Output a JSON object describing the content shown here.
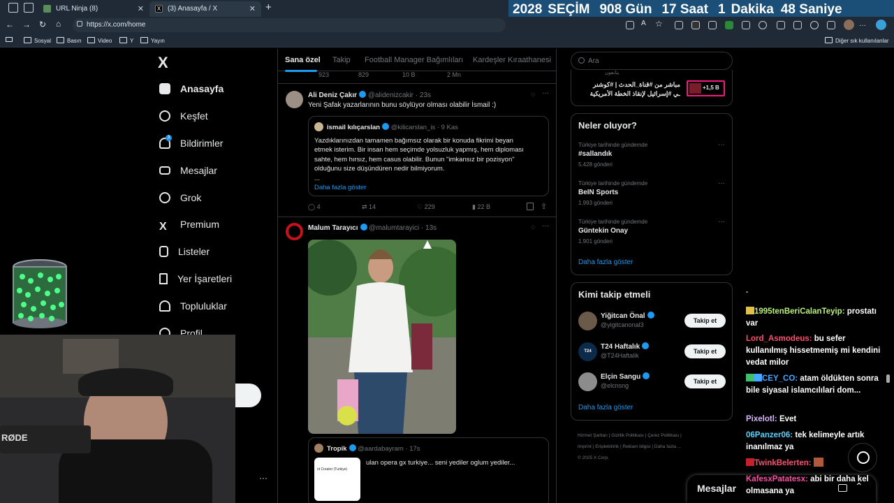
{
  "browser": {
    "tabs": [
      {
        "label": "URL Ninja (8)"
      },
      {
        "label": "(3) Anasayfa / X"
      }
    ],
    "url": "https://x.com/home",
    "bookmarks": [
      "Sosyal",
      "Basın",
      "Video",
      "Y",
      "Yayın"
    ],
    "other_bookmarks": "Diğer sık kullanılanlar",
    "new_tab": "+"
  },
  "timer": {
    "year": "2028",
    "label": "SEÇİM",
    "days": "908 Gün",
    "hours": "17 Saat",
    "minutes_num": "1",
    "minutes_label": "Dakika",
    "seconds": "48 Saniye"
  },
  "sidebar": {
    "logo": "X",
    "items": [
      {
        "label": "Anasayfa"
      },
      {
        "label": "Keşfet"
      },
      {
        "label": "Bildirimler"
      },
      {
        "label": "Mesajlar"
      },
      {
        "label": "Grok"
      },
      {
        "label": "Premium"
      },
      {
        "label": "Listeler"
      },
      {
        "label": "Yer İşaretleri"
      },
      {
        "label": "Topluluklar"
      },
      {
        "label": "Profil"
      }
    ],
    "notification_badge": "3"
  },
  "feed": {
    "tabs": [
      "Sana özel",
      "Takip",
      "Football Manager Bağımlıları",
      "Kardeşler Kıraathanesi"
    ],
    "top_actions": [
      "923",
      "829",
      "10 B",
      "2 Mn"
    ],
    "tweet1": {
      "name": "Ali Deniz Çakır",
      "handle": "@alidenizcakir",
      "time": "· 23s",
      "text": "Yeni Şafak yazarlarının bunu söylüyor olması olabilir İsmail :)",
      "quote": {
        "name": "ismail kılıçarslan",
        "handle": "@kilicarslan_is",
        "time": "· 9 Kas",
        "lines": [
          "Yazdıklarınızdan tamamen bağımsız olarak bir konuda fikrimi beyan",
          "etmek isterim. Bir insan hem seçimde yolsuzluk yapmış, hem diploması",
          "sahte, hem hırsız, hem casus olabilir. Bunun \"imkansız bir pozisyon\"",
          "olduğunu size düşündüren nedir bilmiyorum.",
          "..."
        ],
        "more": "Daha fazla göster"
      },
      "actions": {
        "replies": "4",
        "reposts": "14",
        "likes": "229",
        "views": "22 B"
      }
    },
    "tweet2": {
      "name": "Malum Tarayıcı",
      "handle": "@malumtarayici",
      "time": "· 13s",
      "quote": {
        "name": "Tropik",
        "handle": "@aardabayram",
        "time": "· 17s",
        "text": "ulan opera gx turkiye... seni yediler oglum yediler...",
        "thumb_text": "nt Creator (Turkiye)"
      }
    }
  },
  "right": {
    "search_placeholder": "Ara",
    "ad": {
      "line1": "مباشر من #قناة_الحدث | #كوشنر",
      "line2": "ـي #إسرائيل لإنقاذ الخطة الأمريكية",
      "top": "يتابعون",
      "badge": "+1,5 B"
    },
    "trends_title": "Neler oluyor?",
    "trends": [
      {
        "category": "Türkiye tarihinde gündemde",
        "name": "#sallandık",
        "count": "5.428 gönderi"
      },
      {
        "category": "Türkiye tarihinde gündemde",
        "name": "BeIN Sports",
        "count": "1.993 gönderi"
      },
      {
        "category": "Türkiye tarihinde gündemde",
        "name": "Güntekin Onay",
        "count": "1.901 gönderi"
      }
    ],
    "show_more": "Daha fazla göster",
    "follow_title": "Kimi takip etmeli",
    "follows": [
      {
        "name": "Yiğitcan Önal",
        "handle": "@yigitcanonal3"
      },
      {
        "name": "T24 Haftalık",
        "handle": "@T24Haftalik"
      },
      {
        "name": "Elçin Sangu",
        "handle": "@elcnsng"
      }
    ],
    "follow_label": "Takip et",
    "footer": [
      "Hizmet Şartları",
      "Gizlilik Politikası",
      "Çerez Politikası",
      "Imprint",
      "Erişilebilirlik",
      "Reklam bilgisi",
      "Daha fazla ...",
      "© 2025 X Corp."
    ],
    "messages_label": "Mesajlar"
  },
  "chat": [
    {
      "user": "1995tenBeriCalanTeyip:",
      "user_color": "#b9f07a",
      "text": "prostatı var"
    },
    {
      "user": "Lord_Asmodeus:",
      "user_color": "#ff4d6d",
      "text": "bu sefer kullanılmış hissetmemiş mi kendini vedat milor"
    },
    {
      "user": "CEY_CO:",
      "user_color": "#46a8ff",
      "text": "atam öldükten sonra bile siyasal islamcılılari dom..."
    },
    {
      "user": "Pixelotl:",
      "user_color": "#d7b6ff",
      "text": "Evet"
    },
    {
      "user": "06Panzer06:",
      "user_color": "#57d3ff",
      "text": "tek kelimeyle artık inanılmaz ya"
    },
    {
      "user": "TwinkBelerten:",
      "user_color": "#ff4d6d",
      "text": ""
    },
    {
      "user": "KafesxPatatesx:",
      "user_color": "#ff4da6",
      "text": "abi bir daha kel olmasana ya"
    }
  ],
  "webcam": {
    "mic_brand": "RØDE"
  }
}
